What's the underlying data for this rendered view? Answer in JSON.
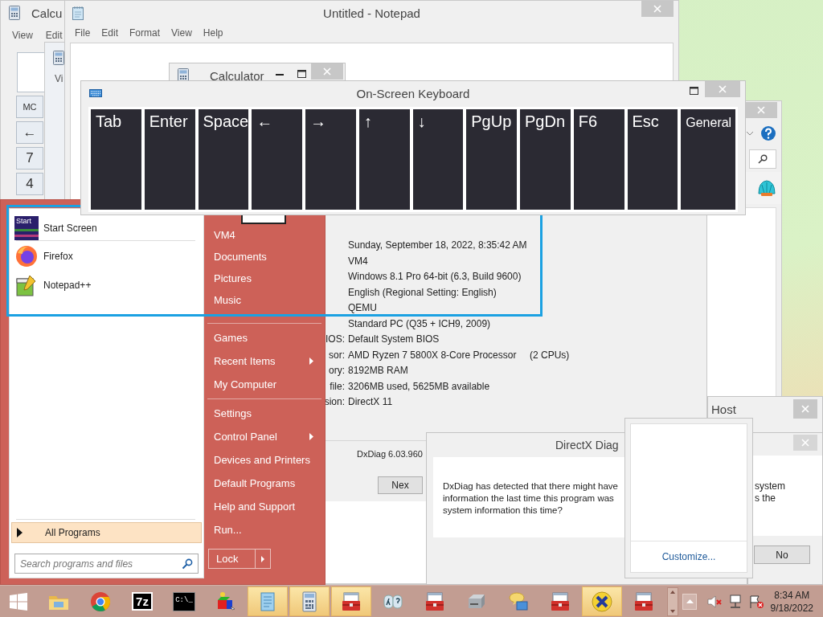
{
  "calculator_back": {
    "title": "Calcu",
    "menu": [
      "View",
      "Edit"
    ],
    "keys": [
      "MC",
      "←",
      "7",
      "4"
    ]
  },
  "calculator_behind": {
    "menu": [
      "Vi"
    ]
  },
  "notepad": {
    "title": "Untitled - Notepad",
    "menu": [
      "File",
      "Edit",
      "Format",
      "View",
      "Help"
    ]
  },
  "system_info": {
    "rows": [
      {
        "value": "Sunday, September 18, 2022, 8:35:42 AM"
      },
      {
        "value": "VM4"
      },
      {
        "value": "Windows 8.1 Pro 64-bit (6.3, Build 9600)"
      },
      {
        "value": "English (Regional Setting: English)"
      },
      {
        "value": "QEMU"
      },
      {
        "value": "Standard PC (Q35 + ICH9, 2009)"
      },
      {
        "label": "IOS:",
        "value": "Default System BIOS"
      },
      {
        "label": "sor:",
        "value": "AMD Ryzen 7 5800X 8-Core Processor",
        "extra": "(2 CPUs)"
      },
      {
        "label": "ory:",
        "value": "8192MB RAM"
      },
      {
        "label": "file:",
        "value": "3206MB used, 5625MB available"
      },
      {
        "label": "sion:",
        "value": "DirectX 11"
      }
    ],
    "footer": "DxDiag 6.03.960",
    "buttons": [
      "Nex"
    ]
  },
  "calculator_front": {
    "title": "Calculator"
  },
  "keyboard": {
    "title": "On-Screen Keyboard",
    "keys": [
      "Tab",
      "Enter",
      "Space",
      "←",
      "→",
      "↑",
      "↓",
      "PgUp",
      "PgDn",
      "F6",
      "Esc",
      "General"
    ]
  },
  "start_menu": {
    "pinned": [
      {
        "label": "Start Screen",
        "icon_text": "Start"
      },
      {
        "label": "Firefox"
      },
      {
        "label": "Notepad++"
      }
    ],
    "all_programs": "All Programs",
    "search": {
      "placeholder": "Search programs and files"
    },
    "groups": [
      {
        "items": [
          {
            "label": "VM4",
            "submenu": false
          },
          {
            "label": "Documents",
            "submenu": false
          },
          {
            "label": "Pictures",
            "submenu": false
          },
          {
            "label": "Music",
            "submenu": false
          }
        ]
      },
      {
        "items": [
          {
            "label": "Games",
            "submenu": false
          },
          {
            "label": "Recent Items",
            "submenu": true
          },
          {
            "label": "My Computer",
            "submenu": false
          }
        ]
      },
      {
        "items": [
          {
            "label": "Settings",
            "submenu": false
          },
          {
            "label": "Control Panel",
            "submenu": true
          },
          {
            "label": "Devices and Printers",
            "submenu": false
          },
          {
            "label": "Default Programs",
            "submenu": false
          },
          {
            "label": "Help and Support",
            "submenu": false
          },
          {
            "label": "Run...",
            "submenu": false
          }
        ]
      }
    ],
    "lock": "Lock"
  },
  "host_window": {
    "title": "Host"
  },
  "back_dialog": {
    "fragments": [
      "system",
      "s the"
    ],
    "button": "No"
  },
  "dxdiag_dialog": {
    "title": "DirectX Diag",
    "lines": [
      "DxDiag has detected that there might have",
      "information the last time this program was",
      "system information this time?"
    ]
  },
  "tray_popup": {
    "link": "Customize..."
  },
  "taskbar": {
    "apps": [
      {
        "active": false
      },
      {
        "active": false
      },
      {
        "label": "7z",
        "active": false
      },
      {
        "label": "C:\\_",
        "active": false
      },
      {
        "active": false
      },
      {
        "active": true
      },
      {
        "active": true
      },
      {
        "active": true
      },
      {
        "active": false
      },
      {
        "active": false
      },
      {
        "active": false
      },
      {
        "active": false
      },
      {
        "active": false
      },
      {
        "active": true
      },
      {
        "active": false
      }
    ],
    "clock": {
      "time": "8:34 AM",
      "date": "9/18/2022"
    }
  }
}
